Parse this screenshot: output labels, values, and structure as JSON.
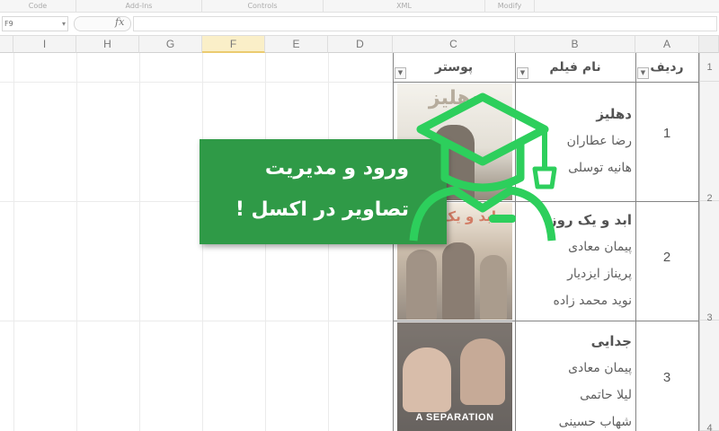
{
  "ribbon": {
    "groups": [
      "Code",
      "Add-Ins",
      "Controls",
      "XML",
      "Modify"
    ]
  },
  "formula_bar": {
    "name_box": "F9",
    "fx_label": "fx"
  },
  "columns": [
    "I",
    "H",
    "G",
    "F",
    "E",
    "D",
    "C",
    "B",
    "A"
  ],
  "selected_column": "F",
  "row_numbers": [
    "1",
    "2",
    "3",
    "4"
  ],
  "table": {
    "headers": {
      "rownum": "ردیف",
      "film": "نام فیلم",
      "poster": "پوستر"
    },
    "rows": [
      {
        "num": "1",
        "title": "دهلیز",
        "cast": [
          "رضا عطاران",
          "هانیه توسلی"
        ]
      },
      {
        "num": "2",
        "title": "ابد و یک روز",
        "cast": [
          "پیمان معادی",
          "پریناز ایزدیار",
          "نوید محمد زاده"
        ]
      },
      {
        "num": "3",
        "title": "جدایی",
        "cast": [
          "پیمان معادی",
          "لیلا حاتمی",
          "شهاب حسینی"
        ]
      }
    ],
    "poster_texts": {
      "p1": "دهلیز",
      "p2": "ابد و یک روز",
      "p3": "A SEPARATION"
    }
  },
  "banner": {
    "line1": "ورود و مدیریت",
    "line2": "تصاویر در اکسل  !",
    "color": "#2f9a47"
  },
  "icons": [
    "graduation-cap-icon",
    "student-icon",
    "filter-dropdown-icon"
  ]
}
